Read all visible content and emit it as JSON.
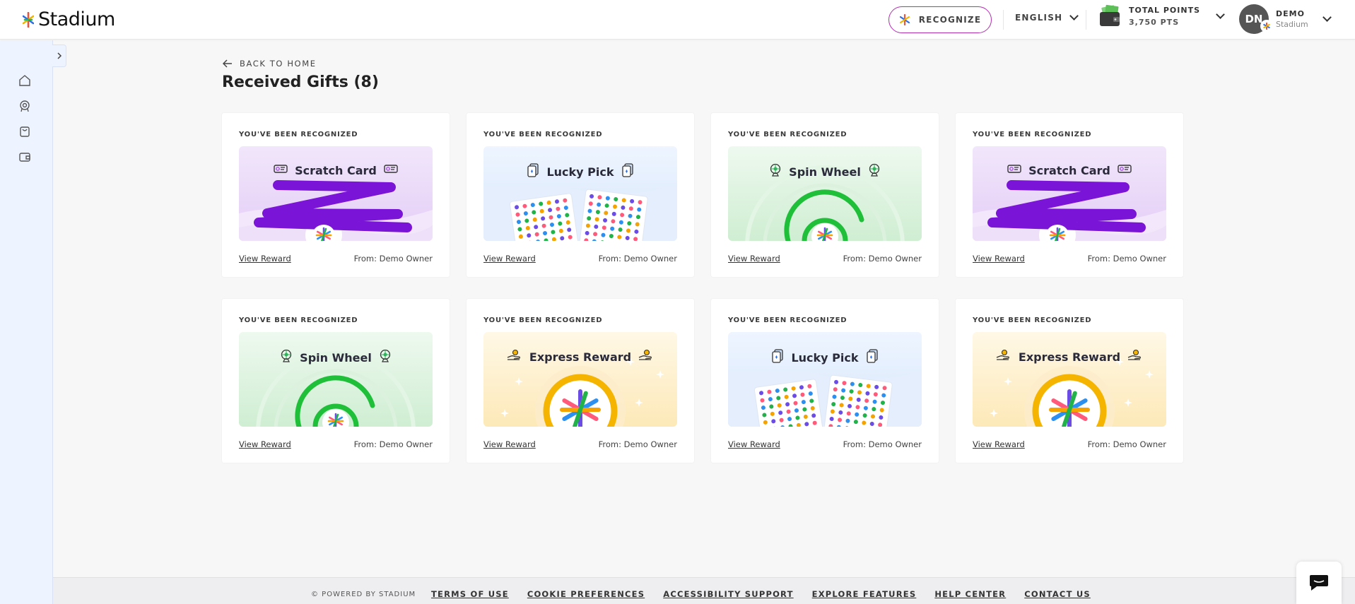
{
  "brand": {
    "name": "Stadium"
  },
  "header": {
    "recognize_label": "RECOGNIZE",
    "language_label": "ENGLISH",
    "points_label": "TOTAL POINTS",
    "points_value": "3,750 PTS",
    "user_initials": "DN",
    "user_name": "DEMO",
    "user_org": "Stadium"
  },
  "sidebar": {
    "icons": [
      "home-icon",
      "medal-icon",
      "shopping-bag-icon",
      "wallet-icon"
    ]
  },
  "main": {
    "back_label": "BACK TO HOME",
    "title": "Received Gifts (8)",
    "cards": [
      {
        "eyebrow": "YOU'VE BEEN RECOGNIZED",
        "type": "Scratch Card",
        "theme": "purple",
        "link": "View Reward",
        "from": "From: Demo Owner"
      },
      {
        "eyebrow": "YOU'VE BEEN RECOGNIZED",
        "type": "Lucky Pick",
        "theme": "blue",
        "link": "View Reward",
        "from": "From: Demo Owner"
      },
      {
        "eyebrow": "YOU'VE BEEN RECOGNIZED",
        "type": "Spin Wheel",
        "theme": "green",
        "link": "View Reward",
        "from": "From: Demo Owner"
      },
      {
        "eyebrow": "YOU'VE BEEN RECOGNIZED",
        "type": "Scratch Card",
        "theme": "purple",
        "link": "View Reward",
        "from": "From: Demo Owner"
      },
      {
        "eyebrow": "YOU'VE BEEN RECOGNIZED",
        "type": "Spin Wheel",
        "theme": "green",
        "link": "View Reward",
        "from": "From: Demo Owner"
      },
      {
        "eyebrow": "YOU'VE BEEN RECOGNIZED",
        "type": "Express Reward",
        "theme": "yellow",
        "link": "View Reward",
        "from": "From: Demo Owner"
      },
      {
        "eyebrow": "YOU'VE BEEN RECOGNIZED",
        "type": "Lucky Pick",
        "theme": "blue",
        "link": "View Reward",
        "from": "From: Demo Owner"
      },
      {
        "eyebrow": "YOU'VE BEEN RECOGNIZED",
        "type": "Express Reward",
        "theme": "yellow",
        "link": "View Reward",
        "from": "From: Demo Owner"
      }
    ]
  },
  "footer": {
    "powered": "© POWERED BY STADIUM",
    "links": [
      "TERMS OF USE",
      "COOKIE PREFERENCES",
      "ACCESSIBILITY SUPPORT",
      "EXPLORE FEATURES",
      "HELP CENTER",
      "CONTACT US"
    ]
  },
  "colors": {
    "accent": "#b22fb2",
    "scratch": "#7a14d6",
    "spin": "#1fbf3a",
    "express": "#f5b400",
    "sidebar_bg": "#eef4ff"
  }
}
